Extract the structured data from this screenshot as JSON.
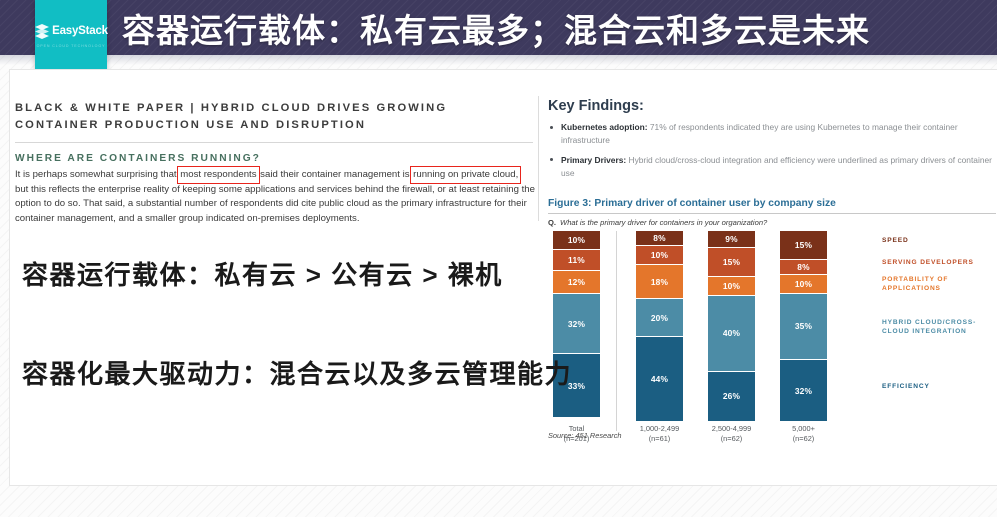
{
  "header": {
    "title": "容器运行载体：私有云最多；混合云和多云是未来",
    "logo_word": "EasyStack",
    "logo_tagline": "OPEN CLOUD TECHNOLOGY",
    "bg_color": "#3e3a5e",
    "logo_bg_color": "#11bec4"
  },
  "document": {
    "kicker": "BLACK & WHITE PAPER | HYBRID CLOUD DRIVES GROWING CONTAINER PRODUCTION USE AND DISRUPTION",
    "section_heading": "WHERE ARE CONTAINERS RUNNING?",
    "body_part_1": "It is perhaps somewhat surprising that ",
    "highlight_1": "most respondents",
    "body_part_2": " said their container management is ",
    "highlight_2": "running on private cloud,",
    "body_part_3": " but this reflects the enterprise reality of keeping some applications and services behind the firewall, or at least retaining the option to do so. That said, a substantial number of respondents did cite public cloud as the primary infrastructure for their container management, and a smaller group indicated on-premises deployments.",
    "highlight_color": "#e8241c"
  },
  "key_findings": {
    "title": "Key Findings:",
    "items": [
      {
        "label": "Kubernetes adoption:",
        "text": " 71% of respondents indicated they are using Kubernetes to manage their container infrastructure"
      },
      {
        "label": "Primary Drivers:",
        "text": " Hybrid cloud/cross-cloud integration and efficiency were underlined as primary drivers of container use"
      }
    ]
  },
  "figure": {
    "title": "Figure 3: Primary driver of container user by company size",
    "question_marker": "Q.",
    "question": "What is the primary driver for containers in your organization?",
    "source": "Source: 451 Research"
  },
  "chart_data": {
    "type": "bar",
    "title": "Figure 3: Primary driver of container user by company size",
    "subtitle": "Q. What is the primary driver for containers in your organization?",
    "stacked": true,
    "unit": "%",
    "xlabel": "",
    "ylabel": "",
    "ylim": [
      0,
      100
    ],
    "grid": false,
    "legend_position": "right",
    "categories": [
      "Total",
      "1,000-2,499",
      "2,500-4,999",
      "5,000+"
    ],
    "category_sublabels": [
      "(n=201)",
      "(n=61)",
      "(n=62)",
      "(n=62)"
    ],
    "series": [
      {
        "name": "SPEED",
        "color": "#7a3119",
        "values": [
          10,
          8,
          9,
          15
        ]
      },
      {
        "name": "SERVING DEVELOPERS",
        "color": "#c04f28",
        "values": [
          11,
          10,
          15,
          8
        ]
      },
      {
        "name": "PORTABILITY OF APPLICATIONS",
        "color": "#e4762b",
        "values": [
          12,
          18,
          10,
          10
        ]
      },
      {
        "name": "HYBRID CLOUD/CROSS-CLOUD INTEGRATION",
        "color": "#4c8ca6",
        "values": [
          32,
          20,
          40,
          35
        ]
      },
      {
        "name": "EFFICIENCY",
        "color": "#1b5e82",
        "values": [
          33,
          44,
          26,
          32
        ]
      }
    ],
    "source": "Source: 451 Research"
  },
  "annotations": {
    "line_1": "容器运行载体：私有云 > 公有云 > 裸机",
    "line_2": "容器化最大驱动力：混合云以及多云管理能力"
  }
}
